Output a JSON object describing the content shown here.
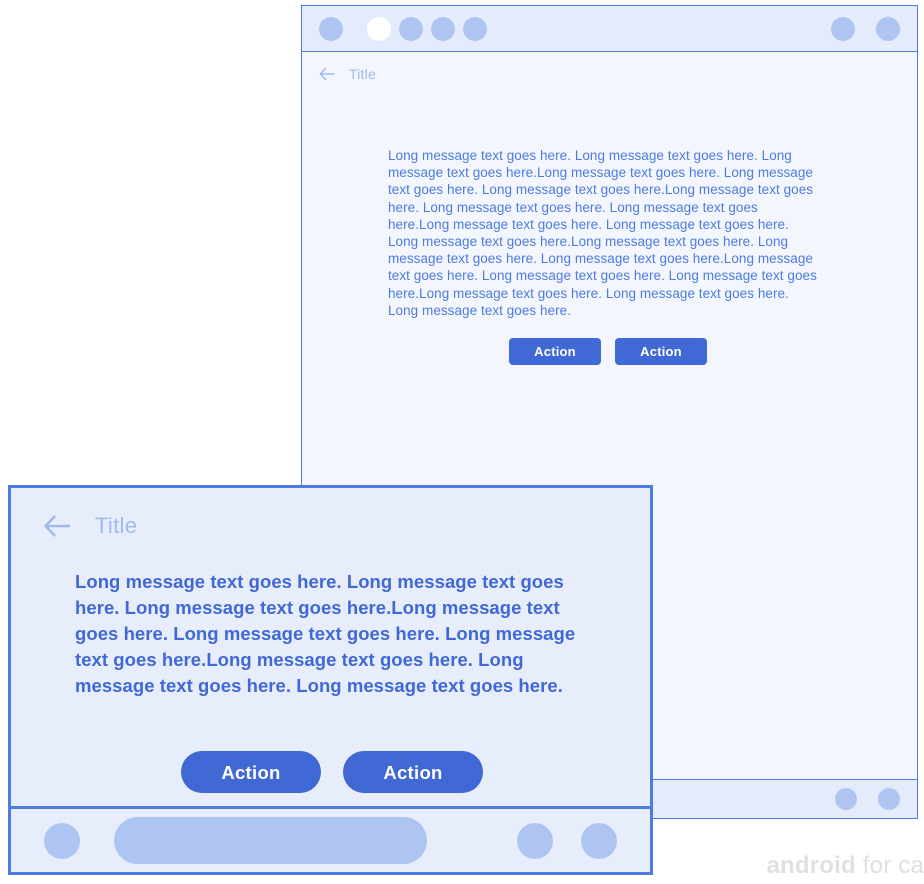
{
  "colors": {
    "accent_blue": "#4069d6",
    "border_blue": "#4d7bdf",
    "soft_blue": "#aec5f2",
    "title_blue": "#9fb9ed",
    "bg_panel": "#f3f6fd",
    "bg_bar": "#e4ebfb",
    "fg_panel": "#e7edfb",
    "watermark_gray": "#e0e0e0"
  },
  "background_window": {
    "name": "spec-preview-window",
    "status_bar": {
      "left_indicators": [
        {
          "name": "status-dot-1",
          "state": "inactive"
        },
        {
          "name": "status-dot-2",
          "state": "active"
        },
        {
          "name": "status-dot-3",
          "state": "inactive"
        },
        {
          "name": "status-dot-4",
          "state": "inactive"
        },
        {
          "name": "status-dot-5",
          "state": "inactive"
        }
      ],
      "right_indicators": [
        {
          "name": "status-icon-1"
        },
        {
          "name": "status-icon-2"
        }
      ]
    },
    "app_bar": {
      "back_icon": "arrow-left-icon",
      "title": "Title"
    },
    "message": "Long message text goes here. Long message text goes here. Long message text goes here.Long message text goes here. Long message text goes here. Long message text goes here.Long message text goes here. Long message text goes here. Long message text goes here.Long message text goes here. Long message text goes here. Long message text goes here.Long message text goes here. Long message text goes here. Long message text goes here.Long message text goes here. Long message text goes here. Long message text goes here.Long message text goes here. Long message text goes here. Long message text goes here.",
    "actions": [
      {
        "label": "Action"
      },
      {
        "label": "Action"
      }
    ],
    "bottom_bar": {
      "left_icon": "nav-circle-icon",
      "right_icons": [
        {
          "name": "nav-icon-1"
        },
        {
          "name": "nav-icon-2"
        }
      ]
    }
  },
  "foreground_dialog": {
    "name": "long-message-detail-dialog",
    "app_bar": {
      "back_icon": "arrow-left-icon",
      "title": "Title"
    },
    "message": "Long message text goes here. Long message text goes here. Long message text goes here.Long message text goes here. Long message text goes here. Long message text goes here.Long message text goes here. Long message text goes here. Long message text goes here.",
    "actions": [
      {
        "label": "Action"
      },
      {
        "label": "Action"
      }
    ],
    "bottom_bar": {
      "left_icon": "nav-circle-icon",
      "search_placeholder": "",
      "right_icons": [
        {
          "name": "nav-icon-1"
        },
        {
          "name": "nav-icon-2"
        }
      ]
    }
  },
  "watermark": {
    "strong": "android",
    "rest": " for ca"
  }
}
